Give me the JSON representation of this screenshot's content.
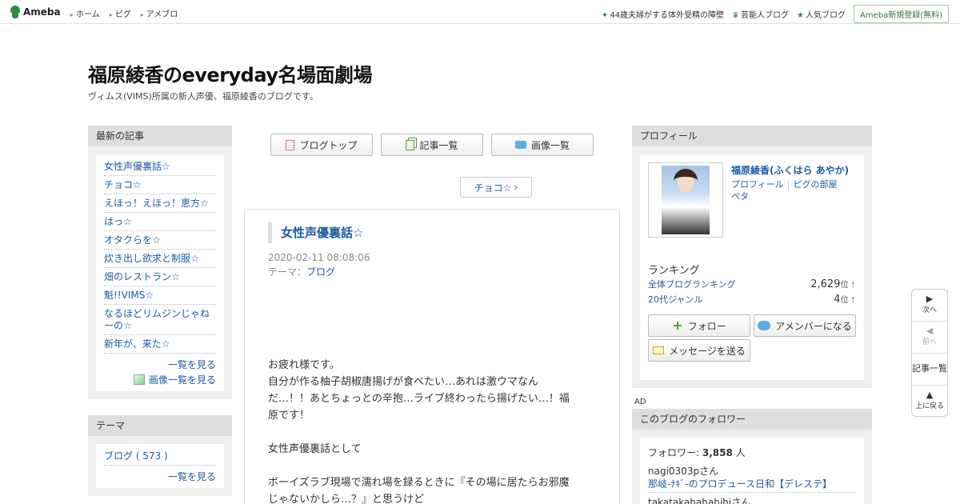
{
  "header": {
    "logo": "Ameba",
    "nav": [
      "ホーム",
      "ピグ",
      "アメブロ"
    ],
    "right_links": [
      "44歳夫婦がする体外受精の障壁",
      "芸能人ブログ",
      "人気ブログ"
    ],
    "register": "Ameba新規登録(無料)"
  },
  "blog": {
    "title": "福原綾香のeveryday名場面劇場",
    "description": "ヴィムス(VIMS)所属の新人声優、福原綾香のブログです。"
  },
  "left_sidebar": {
    "recent_title": "最新の記事",
    "recent_items": [
      "女性声優裏話☆",
      "チョコ☆",
      "えほっ！えほっ！恵方☆",
      "はっ☆",
      "オタクらを☆",
      "炊き出し欲求と制服☆",
      "畑のレストラン☆",
      "魁!!VIMS☆",
      "なるほどリムジンじゃねーの☆",
      "新年が、来た☆"
    ],
    "see_list": "一覧を見る",
    "see_images": "画像一覧を見る",
    "theme_title": "テーマ",
    "theme_items": [
      "ブログ ( 573 )"
    ],
    "theme_see_list": "一覧を見る"
  },
  "center": {
    "buttons": [
      "ブログトップ",
      "記事一覧",
      "画像一覧"
    ],
    "next_article": "チョコ☆",
    "article": {
      "title": "女性声優裏話☆",
      "date": "2020-02-11 08:08:06",
      "theme_label": "テーマ：",
      "theme": "ブログ",
      "body": [
        "お疲れ様です。",
        "自分が作る柚子胡椒唐揚げが食べたい…あれは激ウマなん",
        "だ…！！あとちょっとの辛抱…ライブ終わったら揚げたい…！福",
        "原です！",
        "",
        "女性声優裏話として",
        "",
        "ボーイズラブ現場で濡れ場を録るときに『その場に居たらお邪魔",
        "じゃないかしら…？』と思うけど"
      ]
    }
  },
  "profile": {
    "box_title": "プロフィール",
    "name": "福原綾香(ふくはら あやか)",
    "link_profile": "プロフィール",
    "link_room": "ピグの部屋",
    "link_peta": "ペタ",
    "ranking_title": "ランキング",
    "rankings": [
      {
        "label": "全体ブログランキング",
        "value": "2,629",
        "unit": "位",
        "arrow": "↑"
      },
      {
        "label": "20代ジャンル",
        "value": "4",
        "unit": "位",
        "arrow": "↑"
      }
    ],
    "follow_btn": "フォロー",
    "amember_btn": "アメンバーになる",
    "message_btn": "メッセージを送る"
  },
  "ad_label": "AD",
  "followers": {
    "box_title": "このブログのフォロワー",
    "count_label": "フォロワー:",
    "count": "3,858",
    "count_unit": "人",
    "users": [
      {
        "name": "nagi0303pさん",
        "blog": "那岐-ﾅｷﾞ-のプロデュース日和【デレステ】"
      },
      {
        "name": "takatakahahahihiさん",
        "blog": ""
      }
    ]
  },
  "floatnav": {
    "next": "次へ",
    "prev": "前へ",
    "list": "記事一覧",
    "top": "上に戻る"
  }
}
